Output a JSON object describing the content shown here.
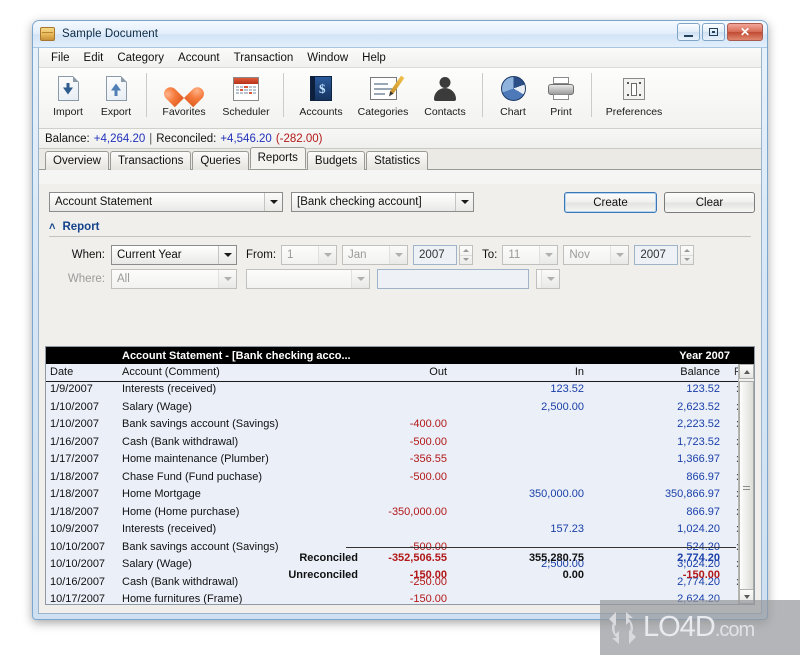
{
  "window": {
    "title": "Sample Document",
    "icon": "document-safe-icon",
    "buttons": {
      "minimize": "–",
      "maximize": "□",
      "close": "✕"
    }
  },
  "menubar": {
    "items": [
      "File",
      "Edit",
      "Category",
      "Account",
      "Transaction",
      "Window",
      "Help"
    ]
  },
  "toolbar": {
    "groups": [
      {
        "items": [
          {
            "label": "Import",
            "icon": "import-document-icon"
          },
          {
            "label": "Export",
            "icon": "export-document-icon"
          }
        ]
      },
      {
        "items": [
          {
            "label": "Favorites",
            "icon": "heart-icon"
          },
          {
            "label": "Scheduler",
            "icon": "calendar-icon"
          }
        ]
      },
      {
        "items": [
          {
            "label": "Accounts",
            "icon": "book-dollar-icon"
          },
          {
            "label": "Categories",
            "icon": "paper-pen-icon"
          },
          {
            "label": "Contacts",
            "icon": "person-icon"
          }
        ]
      },
      {
        "items": [
          {
            "label": "Chart",
            "icon": "pie-chart-icon"
          },
          {
            "label": "Print",
            "icon": "printer-icon"
          }
        ]
      },
      {
        "items": [
          {
            "label": "Preferences",
            "icon": "preferences-switch-icon"
          }
        ]
      }
    ]
  },
  "balance_bar": {
    "balance_label": "Balance:",
    "balance_value": "+4,264.20",
    "separator": "|",
    "reconciled_label": "Reconciled:",
    "reconciled_value": "+4,546.20",
    "difference": "(-282.00)"
  },
  "tabs": {
    "items": [
      "Overview",
      "Transactions",
      "Queries",
      "Reports",
      "Budgets",
      "Statistics"
    ],
    "active": "Reports"
  },
  "selectors": {
    "report_type": "Account Statement",
    "account": "[Bank checking account]",
    "create_button": "Create",
    "clear_button": "Clear"
  },
  "report_group": {
    "title": "Report",
    "collapse_icon": "chevron-up-icon"
  },
  "filters": {
    "when_label": "When:",
    "when_value": "Current Year",
    "from_label": "From:",
    "from_day": "1",
    "from_month": "Jan",
    "from_year": "2007",
    "to_label": "To:",
    "to_day": "11",
    "to_month": "Nov",
    "to_year": "2007",
    "where_label": "Where:",
    "where_value": "All",
    "where_op_value": "",
    "where_text_value": ""
  },
  "report": {
    "title": "Account Statement - [Bank checking acco...",
    "year": "Year 2007",
    "columns": [
      "Date",
      "Account (Comment)",
      "Out",
      "In",
      "Balance",
      "R"
    ],
    "rows": [
      {
        "date": "1/9/2007",
        "account": "Interests (received)",
        "out": "",
        "in": "123.52",
        "balance": "123.52",
        "r": "x"
      },
      {
        "date": "1/10/2007",
        "account": "Salary (Wage)",
        "out": "",
        "in": "2,500.00",
        "balance": "2,623.52",
        "r": "x"
      },
      {
        "date": "1/10/2007",
        "account": "Bank savings account (Savings)",
        "out": "-400.00",
        "in": "",
        "balance": "2,223.52",
        "r": "x"
      },
      {
        "date": "1/16/2007",
        "account": "Cash (Bank withdrawal)",
        "out": "-500.00",
        "in": "",
        "balance": "1,723.52",
        "r": "x"
      },
      {
        "date": "1/17/2007",
        "account": "Home maintenance (Plumber)",
        "out": "-356.55",
        "in": "",
        "balance": "1,366.97",
        "r": "x"
      },
      {
        "date": "1/18/2007",
        "account": "Chase Fund (Fund puchase)",
        "out": "-500.00",
        "in": "",
        "balance": "866.97",
        "r": "x"
      },
      {
        "date": "1/18/2007",
        "account": "Home Mortgage",
        "out": "",
        "in": "350,000.00",
        "balance": "350,866.97",
        "r": "x"
      },
      {
        "date": "1/18/2007",
        "account": "Home (Home purchase)",
        "out": "-350,000.00",
        "in": "",
        "balance": "866.97",
        "r": "x"
      },
      {
        "date": "10/9/2007",
        "account": "Interests (received)",
        "out": "",
        "in": "157.23",
        "balance": "1,024.20",
        "r": "x"
      },
      {
        "date": "10/10/2007",
        "account": "Bank savings account (Savings)",
        "out": "-500.00",
        "in": "",
        "balance": "524.20",
        "r": "x"
      },
      {
        "date": "10/10/2007",
        "account": "Salary (Wage)",
        "out": "",
        "in": "2,500.00",
        "balance": "3,024.20",
        "r": "x"
      },
      {
        "date": "10/16/2007",
        "account": "Cash (Bank withdrawal)",
        "out": "-250.00",
        "in": "",
        "balance": "2,774.20",
        "r": "x"
      },
      {
        "date": "10/17/2007",
        "account": "Home furnitures (Frame)",
        "out": "-150.00",
        "in": "",
        "balance": "2,624.20",
        "r": ""
      }
    ],
    "totals": [
      {
        "label": "Reconciled",
        "out": "-352,506.55",
        "in": "355,280.75",
        "balance": "2,774.20",
        "balance_negative": false
      },
      {
        "label": "Unreconciled",
        "out": "-150.00",
        "in": "0.00",
        "balance": "-150.00",
        "balance_negative": true
      }
    ]
  },
  "watermark": {
    "text": "LO4D",
    "suffix": ".com",
    "icon": "refresh-arrows-icon"
  },
  "colors": {
    "accent": "#15428b",
    "positive": "#2233bb",
    "negative": "#b31818",
    "title_bar": "#d2e4f7",
    "report_header_bg": "#000000"
  }
}
